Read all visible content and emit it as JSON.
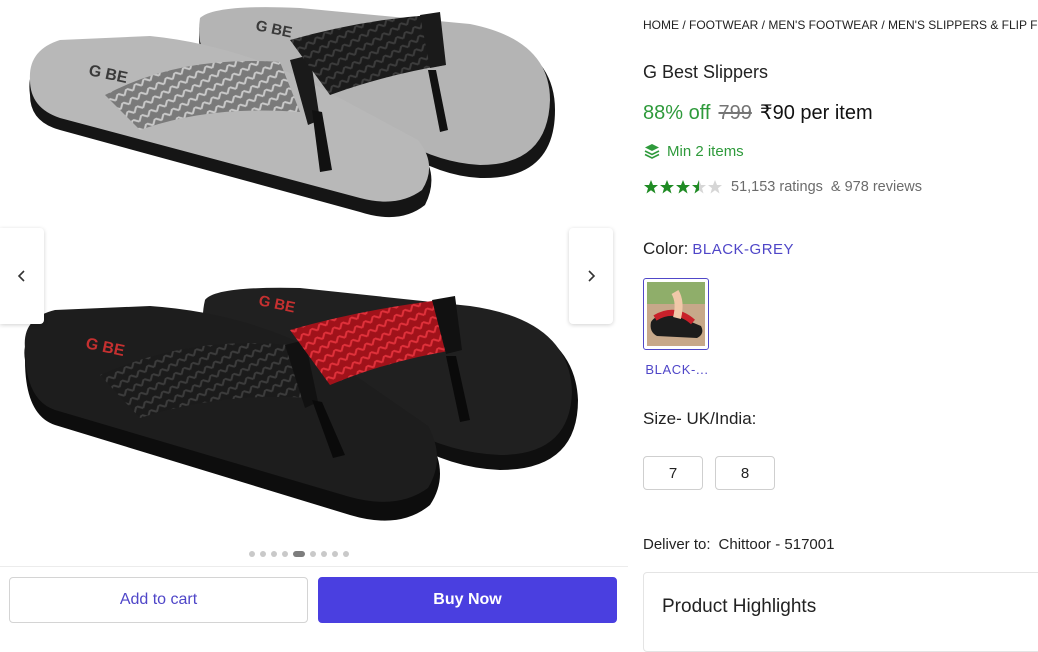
{
  "gallery": {
    "slide_count": 9,
    "active_slide": 5,
    "prev_icon": "chevron-left-icon",
    "next_icon": "chevron-right-icon"
  },
  "actions": {
    "add_to_cart": "Add to cart",
    "buy_now": "Buy Now"
  },
  "breadcrumb": [
    "Home",
    "Footwear",
    "Men's Footwear",
    "Men's Slippers & Flip Flops"
  ],
  "product": {
    "title": "G Best Slippers",
    "discount": "88% off",
    "mrp": "799",
    "price": "₹90 per item",
    "min_qty_icon": "stack-layers-icon",
    "min_qty": "Min 2 items",
    "rating_value": 3.5,
    "ratings_text": "51,153 ratings",
    "reviews_text": "& 978 reviews"
  },
  "color": {
    "label": "Color:",
    "selected": "BLACK-GREY",
    "swatch_label": "BLACK-..."
  },
  "size": {
    "label": "Size- UK/India:",
    "options": [
      "7",
      "8"
    ]
  },
  "delivery": {
    "label": "Deliver to:",
    "location": "Chittoor - 517001"
  },
  "highlights": {
    "title": "Product Highlights"
  },
  "colors": {
    "accent": "#4a3fe0",
    "accent_text": "#4f46c8",
    "discount_green": "#2e9a3b",
    "star_green": "#1f8b24"
  }
}
